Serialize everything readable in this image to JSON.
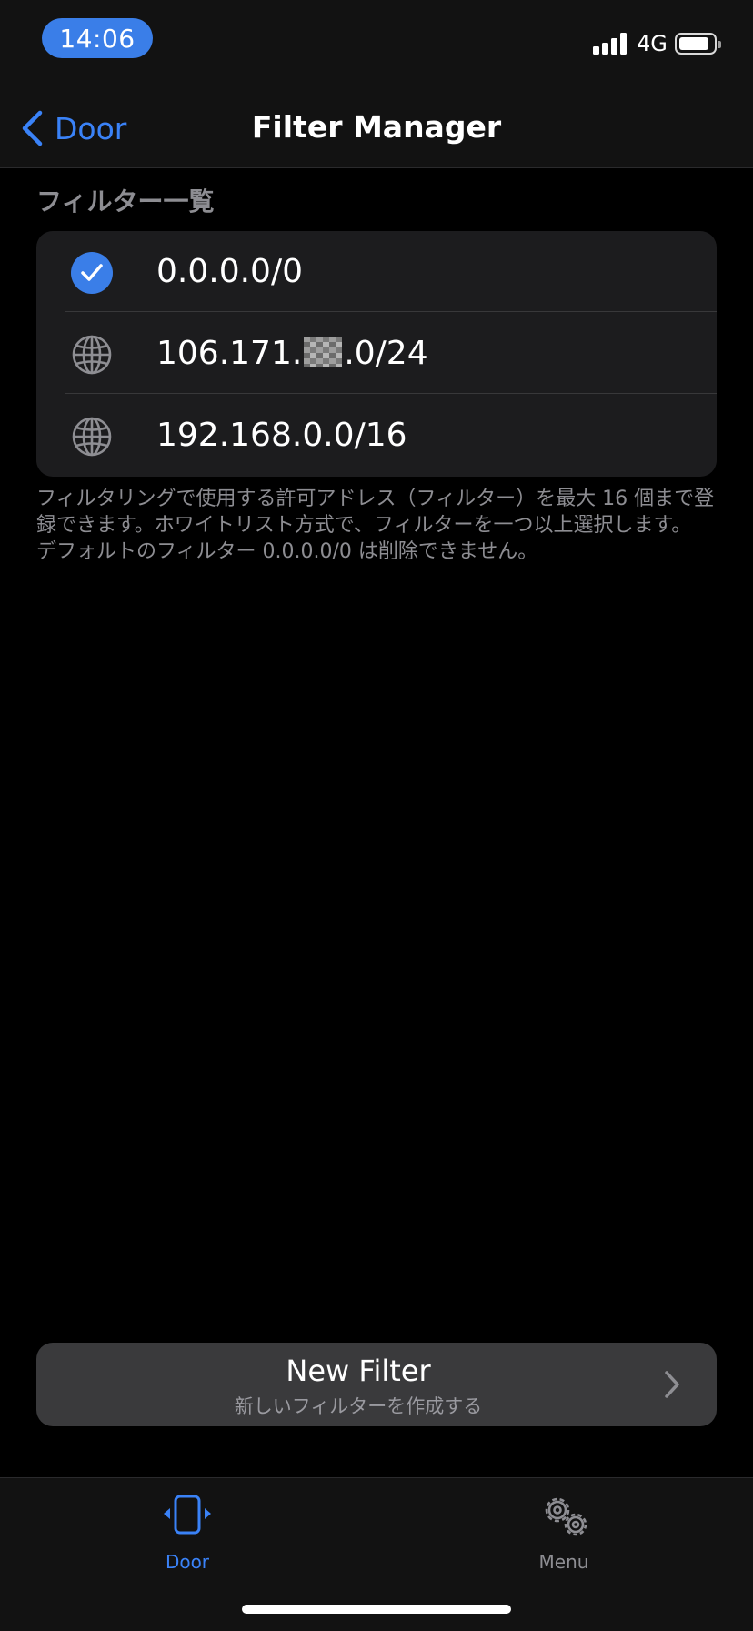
{
  "status_bar": {
    "time": "14:06",
    "network": "4G"
  },
  "nav": {
    "back_label": "Door",
    "title": "Filter Manager"
  },
  "section": {
    "title": "フィルター一覧",
    "items": [
      {
        "label": "0.0.0.0/0",
        "selected": true,
        "icon": "checkmark-circle-icon"
      },
      {
        "label_prefix": "106.171.",
        "label_suffix": ".0/24",
        "selected": false,
        "icon": "globe-icon"
      },
      {
        "label": "192.168.0.0/16",
        "selected": false,
        "icon": "globe-icon"
      }
    ],
    "footnote_line1": "フィルタリングで使用する許可アドレス（フィルター）を最大 16 個まで登録できます。ホワイトリスト方式で、フィルターを一つ以上選択します。",
    "footnote_line2": "デフォルトのフィルター 0.0.0.0/0 は削除できません。"
  },
  "new_filter": {
    "title": "New Filter",
    "subtitle": "新しいフィルターを作成する"
  },
  "tab_bar": {
    "tabs": [
      {
        "label": "Door",
        "icon": "door-phone-icon",
        "active": true
      },
      {
        "label": "Menu",
        "icon": "gears-icon",
        "active": false
      }
    ]
  },
  "colors": {
    "accent": "#3a82f7",
    "background": "#000000",
    "card": "#1c1c1e",
    "secondary_text": "#8d8d92"
  }
}
